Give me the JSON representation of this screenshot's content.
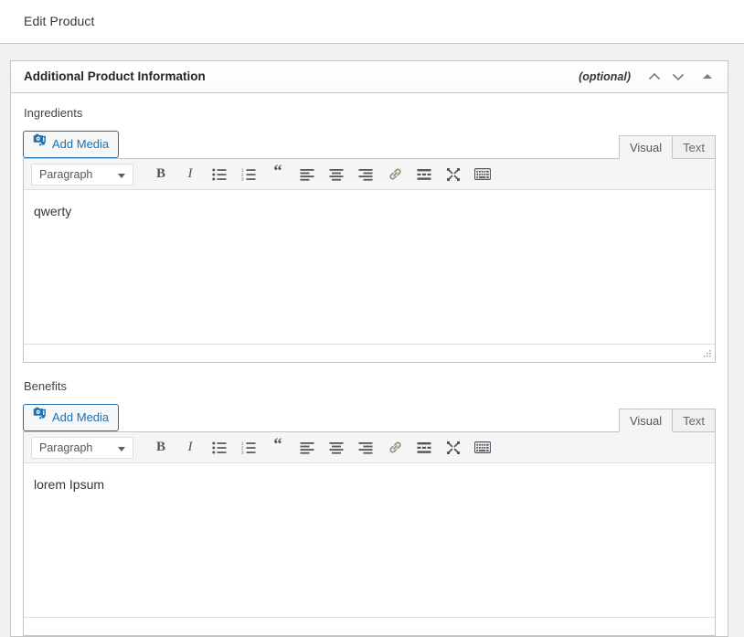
{
  "topbar": {
    "title": "Edit Product"
  },
  "metabox": {
    "title": "Additional Product Information",
    "optional_label": "(optional)",
    "move_up_icon": "chevron-up-icon",
    "move_down_icon": "chevron-down-icon",
    "toggle_icon": "triangle-up-icon"
  },
  "editors": [
    {
      "label": "Ingredients",
      "add_media_label": "Add Media",
      "add_media_icon": "add-media-icon",
      "tabs": [
        {
          "label": "Visual",
          "active": true
        },
        {
          "label": "Text",
          "active": false
        }
      ],
      "toolbar": {
        "format_value": "Paragraph",
        "buttons": [
          {
            "name": "bold-icon",
            "glyph": "B"
          },
          {
            "name": "italic-icon",
            "glyph": "I"
          },
          {
            "name": "bulleted-list-icon",
            "glyph": ""
          },
          {
            "name": "numbered-list-icon",
            "glyph": ""
          },
          {
            "name": "blockquote-icon",
            "glyph": "“"
          },
          {
            "name": "align-left-icon",
            "glyph": ""
          },
          {
            "name": "align-center-icon",
            "glyph": ""
          },
          {
            "name": "align-right-icon",
            "glyph": ""
          },
          {
            "name": "insert-link-icon",
            "glyph": ""
          },
          {
            "name": "read-more-icon",
            "glyph": ""
          },
          {
            "name": "fullscreen-icon",
            "glyph": ""
          },
          {
            "name": "toolbar-toggle-icon",
            "glyph": ""
          }
        ]
      },
      "content": "qwerty",
      "has_resize_grip": true
    },
    {
      "label": "Benefits",
      "add_media_label": "Add Media",
      "add_media_icon": "add-media-icon",
      "tabs": [
        {
          "label": "Visual",
          "active": true
        },
        {
          "label": "Text",
          "active": false
        }
      ],
      "toolbar": {
        "format_value": "Paragraph",
        "buttons": [
          {
            "name": "bold-icon",
            "glyph": "B"
          },
          {
            "name": "italic-icon",
            "glyph": "I"
          },
          {
            "name": "bulleted-list-icon",
            "glyph": ""
          },
          {
            "name": "numbered-list-icon",
            "glyph": ""
          },
          {
            "name": "blockquote-icon",
            "glyph": "“"
          },
          {
            "name": "align-left-icon",
            "glyph": ""
          },
          {
            "name": "align-center-icon",
            "glyph": ""
          },
          {
            "name": "align-right-icon",
            "glyph": ""
          },
          {
            "name": "insert-link-icon",
            "glyph": ""
          },
          {
            "name": "read-more-icon",
            "glyph": ""
          },
          {
            "name": "fullscreen-icon",
            "glyph": ""
          },
          {
            "name": "toolbar-toggle-icon",
            "glyph": ""
          }
        ]
      },
      "content": "lorem Ipsum",
      "has_resize_grip": false
    }
  ],
  "colors": {
    "accent_blue": "#2271b1",
    "page_bg": "#f1f1f1",
    "border": "#c3c4c7",
    "text": "#32373c",
    "toolbar_icon": "#50575e"
  }
}
